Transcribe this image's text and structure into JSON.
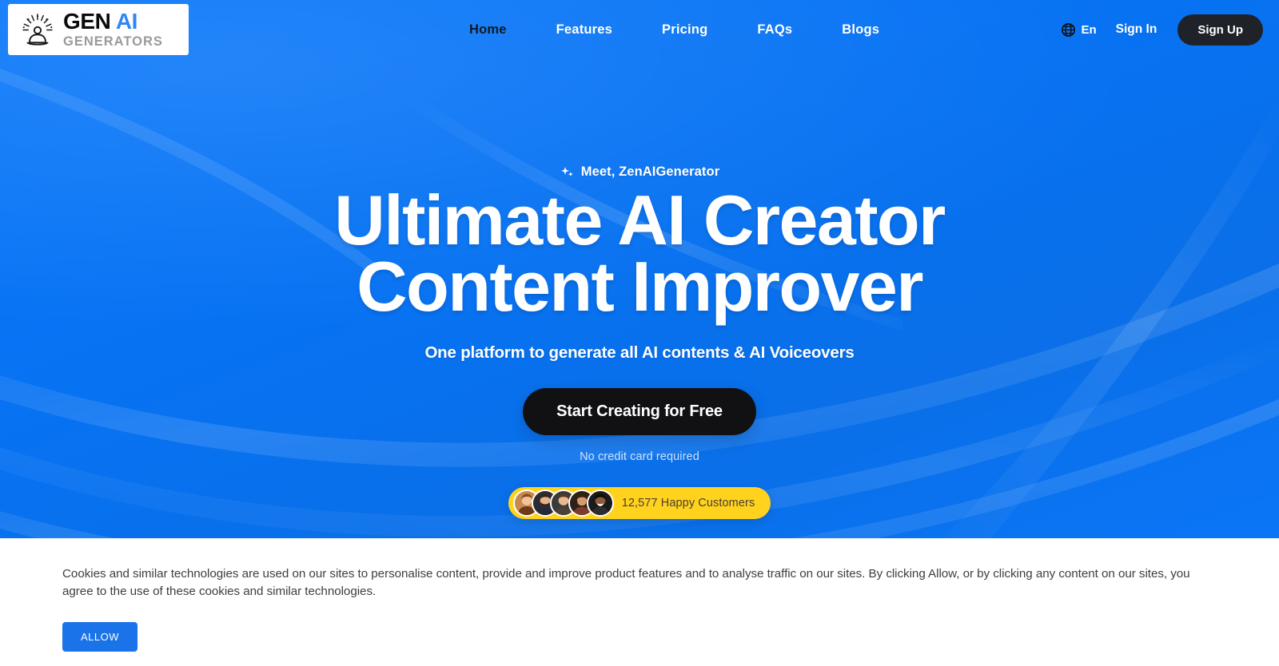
{
  "brand": {
    "logo_line1_a": "GEN",
    "logo_line1_b": "AI",
    "logo_line2": "GENERATORS",
    "logo_icon": "meditating-figure-icon"
  },
  "nav": {
    "links": [
      {
        "label": "Home",
        "active": true
      },
      {
        "label": "Features",
        "active": false
      },
      {
        "label": "Pricing",
        "active": false
      },
      {
        "label": "FAQs",
        "active": false
      },
      {
        "label": "Blogs",
        "active": false
      }
    ],
    "language": {
      "icon": "globe-icon",
      "label": "En"
    },
    "sign_in": "Sign In",
    "sign_up": "Sign Up"
  },
  "hero": {
    "eyebrow_icon": "sparkles-icon",
    "eyebrow": "Meet, ZenAIGenerator",
    "headline_line1": "Ultimate AI Creator",
    "headline_line2": "Content Improver",
    "subhead": "One platform to generate all AI contents & AI Voiceovers",
    "cta": "Start Creating for Free",
    "no_card": "No credit card required",
    "customers": "12,577 Happy Customers",
    "avatar_count": 5
  },
  "cookie": {
    "text": "Cookies and similar technologies are used on our sites to personalise content, provide and improve product features and to analyse traffic on our sites. By clicking Allow, or by clicking any content on our sites, you agree to the use of these cookies and similar technologies.",
    "allow_label": "ALLOW"
  },
  "colors": {
    "hero_blue": "#0772f2",
    "accent_blue": "#2f86f6",
    "dark": "#1f2229",
    "yellow": "#ffd21e",
    "allow_blue": "#1a73e8"
  }
}
